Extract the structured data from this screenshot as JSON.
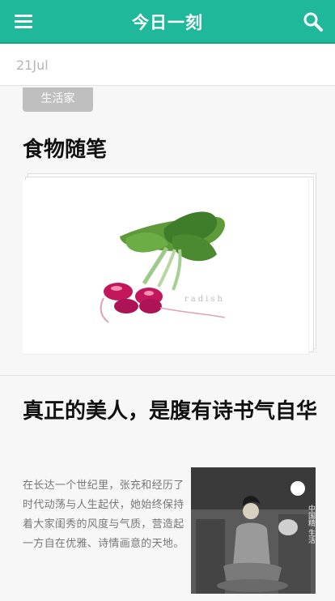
{
  "header": {
    "title": "今日一刻",
    "menu_icon": "hamburger-menu-icon",
    "search_icon": "search-icon",
    "bg_color": "#1fb89a"
  },
  "date_bar": {
    "date": "21Jul"
  },
  "articles": [
    {
      "category": "生活家",
      "title": "食物随笔",
      "image_caption": "radish"
    },
    {
      "title": "真正的美人，是腹有诗书气自华",
      "excerpt": "在长达一个世纪里，张充和经历了时代动荡与人生起伏，她始终保持着大家闺秀的风度与气质，营造起一方自在优雅、诗情画意的天地。",
      "cover_text": "中国精    生活"
    }
  ]
}
